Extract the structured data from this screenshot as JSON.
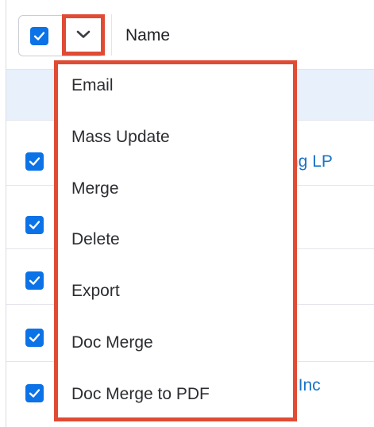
{
  "header": {
    "name_column": "Name"
  },
  "mass_actions_menu": {
    "items": [
      {
        "label": "Email"
      },
      {
        "label": "Mass Update"
      },
      {
        "label": "Merge"
      },
      {
        "label": "Delete"
      },
      {
        "label": "Export"
      },
      {
        "label": "Doc Merge"
      },
      {
        "label": "Doc Merge to PDF"
      }
    ]
  },
  "rows": [
    {
      "link_text": "",
      "checked": true,
      "highlighted": true
    },
    {
      "link_text": "ng LP",
      "checked": true
    },
    {
      "link_text": "",
      "checked": true
    },
    {
      "link_text": "",
      "checked": true
    },
    {
      "link_text": "",
      "checked": true
    },
    {
      "link_text": "t Inc",
      "checked": true
    }
  ],
  "colors": {
    "checkbox": "#0b72e7",
    "highlight_border": "#e04b34",
    "link": "#1a73c7",
    "selected_row_bg": "#e8f1fb"
  },
  "icons": {
    "header_checkbox": "checked-checkbox-icon",
    "dropdown_toggle": "chevron-down-icon"
  }
}
